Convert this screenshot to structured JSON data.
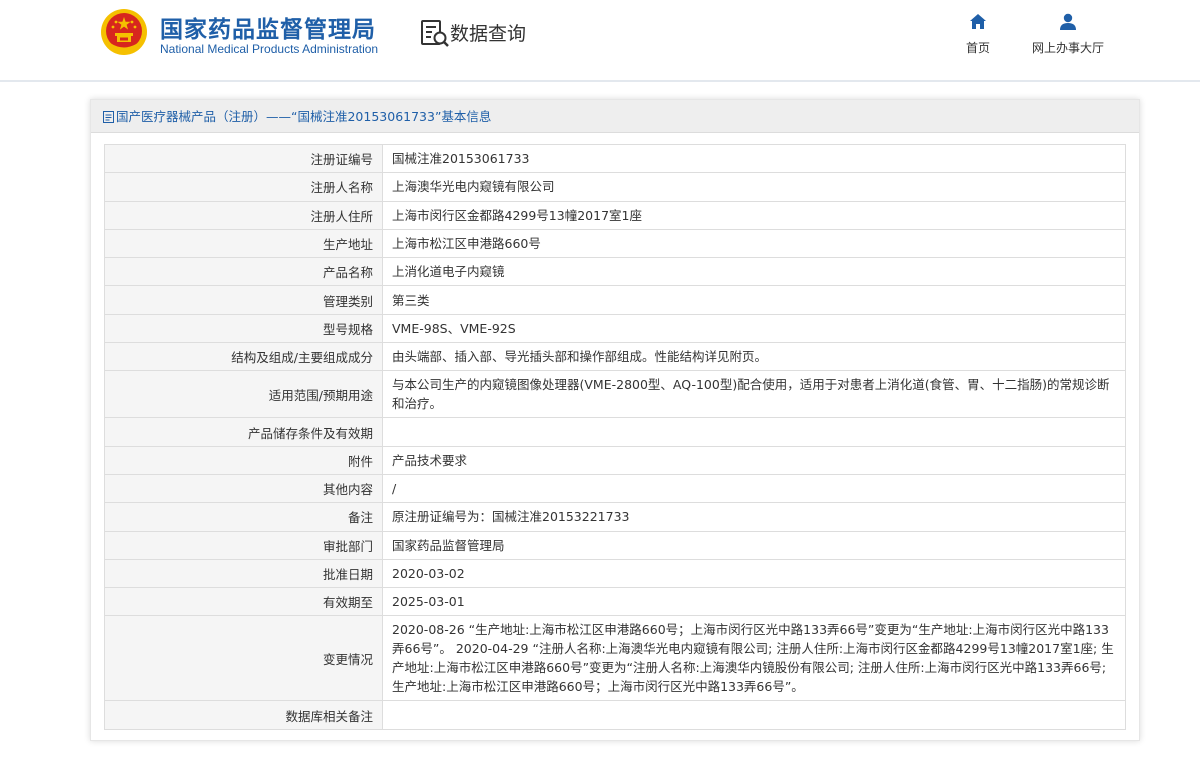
{
  "header": {
    "logo_cn": "国家药品监督管理局",
    "logo_en": "National Medical Products Administration",
    "query_title": "数据查询",
    "nav": [
      {
        "label": "首页",
        "icon": "home-icon"
      },
      {
        "label": "网上办事大厅",
        "icon": "user-icon"
      }
    ]
  },
  "panel": {
    "title": "国产医疗器械产品（注册）——“国械注准20153061733”基本信息",
    "rows": [
      {
        "label": "注册证编号",
        "value": "国械注准20153061733"
      },
      {
        "label": "注册人名称",
        "value": "上海澳华光电内窥镜有限公司"
      },
      {
        "label": "注册人住所",
        "value": "上海市闵行区金都路4299号13幢2017室1座"
      },
      {
        "label": "生产地址",
        "value": "上海市松江区申港路660号"
      },
      {
        "label": "产品名称",
        "value": "上消化道电子内窥镜"
      },
      {
        "label": "管理类别",
        "value": "第三类"
      },
      {
        "label": "型号规格",
        "value": "VME-98S、VME-92S"
      },
      {
        "label": "结构及组成/主要组成成分",
        "value": "由头端部、插入部、导光插头部和操作部组成。性能结构详见附页。"
      },
      {
        "label": "适用范围/预期用途",
        "value": "与本公司生产的内窥镜图像处理器(VME-2800型、AQ-100型)配合使用，适用于对患者上消化道(食管、胃、十二指肠)的常规诊断和治疗。"
      },
      {
        "label": "产品储存条件及有效期",
        "value": ""
      },
      {
        "label": "附件",
        "value": "产品技术要求"
      },
      {
        "label": "其他内容",
        "value": "/"
      },
      {
        "label": "备注",
        "value": "原注册证编号为：国械注准20153221733"
      },
      {
        "label": "审批部门",
        "value": "国家药品监督管理局"
      },
      {
        "label": "批准日期",
        "value": "2020-03-02"
      },
      {
        "label": "有效期至",
        "value": "2025-03-01"
      },
      {
        "label": "变更情况",
        "value": "2020-08-26 “生产地址:上海市松江区申港路660号；上海市闵行区光中路133弄66号”变更为“生产地址:上海市闵行区光中路133弄66号”。 2020-04-29 “注册人名称:上海澳华光电内窥镜有限公司; 注册人住所:上海市闵行区金都路4299号13幢2017室1座; 生产地址:上海市松江区申港路660号”变更为“注册人名称:上海澳华内镜股份有限公司; 注册人住所:上海市闵行区光中路133弄66号; 生产地址:上海市松江区申港路660号；上海市闵行区光中路133弄66号”。"
      },
      {
        "label": "数据库相关备注",
        "value": ""
      }
    ]
  },
  "colors": {
    "brand_blue": "#1f5fa8",
    "emblem_red": "#d7261e",
    "emblem_gold": "#f5c000"
  }
}
